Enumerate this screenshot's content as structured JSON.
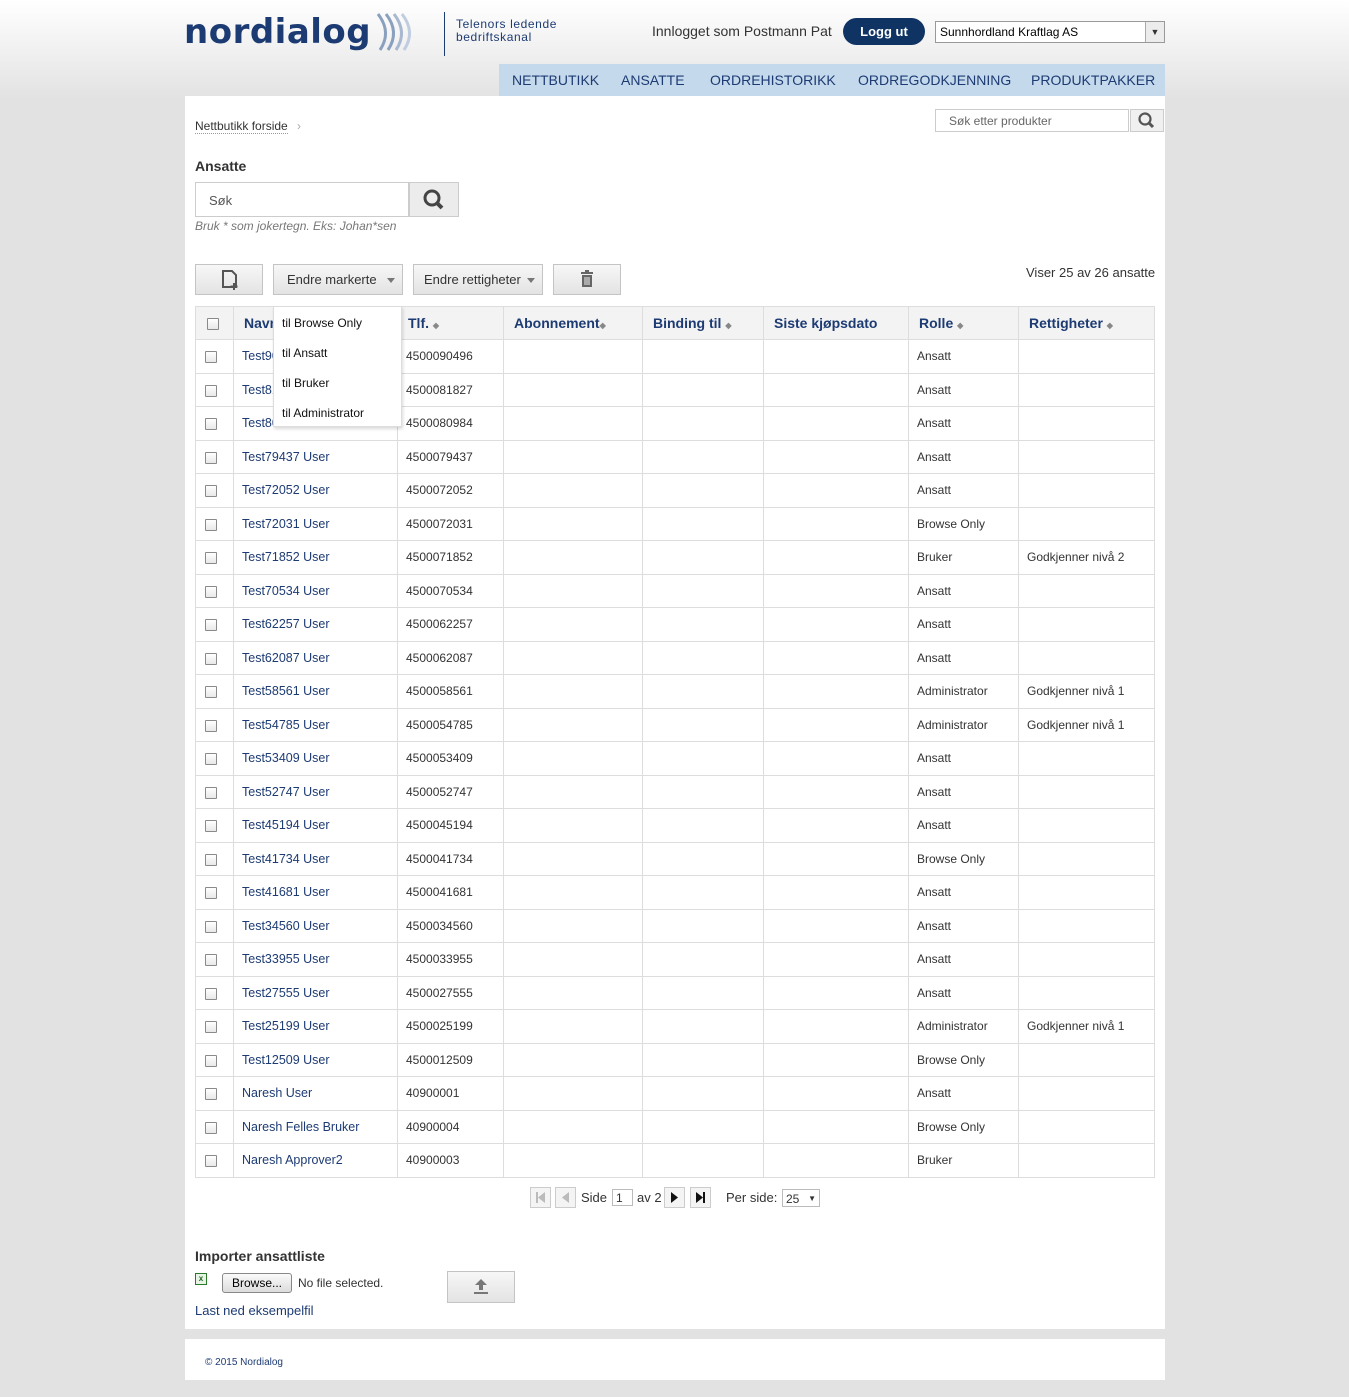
{
  "header": {
    "logo_text": "nordialog",
    "tagline_line1": "Telenors ledende",
    "tagline_line2": "bedriftskanal",
    "logged_in_text": "Innlogget som Postmann Pat",
    "logout_label": "Logg ut",
    "company_selected": "Sunnhordland Kraftlag AS"
  },
  "nav": {
    "items": [
      "NETTBUTIKK",
      "ANSATTE",
      "ORDREHISTORIKK",
      "ORDREGODKJENNING",
      "PRODUKTPAKKER"
    ]
  },
  "breadcrumb": {
    "home": "Nettbutikk forside"
  },
  "product_search": {
    "placeholder": "Søk etter produkter"
  },
  "page": {
    "title": "Ansatte",
    "search_placeholder": "Søk",
    "search_hint": "Bruk * som jokertegn. Eks: Johan*sen",
    "count_text": "Viser 25 av 26 ansatte"
  },
  "toolbar": {
    "change_marked_label": "Endre markerte",
    "change_rights_label": "Endre rettigheter"
  },
  "dropdown": {
    "options": [
      "til Browse Only",
      "til Ansatt",
      "til Bruker",
      "til Administrator"
    ]
  },
  "table": {
    "columns": [
      "Navn",
      "Tlf.",
      "Abonnement",
      "Binding til",
      "Siste kjøpsdato",
      "Rolle",
      "Rettigheter"
    ],
    "rows": [
      {
        "name": "Test90496 User",
        "phone": "4500090496",
        "role": "Ansatt",
        "rights": ""
      },
      {
        "name": "Test81827 User",
        "phone": "4500081827",
        "role": "Ansatt",
        "rights": ""
      },
      {
        "name": "Test80984 User",
        "phone": "4500080984",
        "role": "Ansatt",
        "rights": ""
      },
      {
        "name": "Test79437 User",
        "phone": "4500079437",
        "role": "Ansatt",
        "rights": ""
      },
      {
        "name": "Test72052 User",
        "phone": "4500072052",
        "role": "Ansatt",
        "rights": ""
      },
      {
        "name": "Test72031 User",
        "phone": "4500072031",
        "role": "Browse Only",
        "rights": ""
      },
      {
        "name": "Test71852 User",
        "phone": "4500071852",
        "role": "Bruker",
        "rights": "Godkjenner nivå 2"
      },
      {
        "name": "Test70534 User",
        "phone": "4500070534",
        "role": "Ansatt",
        "rights": ""
      },
      {
        "name": "Test62257 User",
        "phone": "4500062257",
        "role": "Ansatt",
        "rights": ""
      },
      {
        "name": "Test62087 User",
        "phone": "4500062087",
        "role": "Ansatt",
        "rights": ""
      },
      {
        "name": "Test58561 User",
        "phone": "4500058561",
        "role": "Administrator",
        "rights": "Godkjenner nivå 1"
      },
      {
        "name": "Test54785 User",
        "phone": "4500054785",
        "role": "Administrator",
        "rights": "Godkjenner nivå 1"
      },
      {
        "name": "Test53409 User",
        "phone": "4500053409",
        "role": "Ansatt",
        "rights": ""
      },
      {
        "name": "Test52747 User",
        "phone": "4500052747",
        "role": "Ansatt",
        "rights": ""
      },
      {
        "name": "Test45194 User",
        "phone": "4500045194",
        "role": "Ansatt",
        "rights": ""
      },
      {
        "name": "Test41734 User",
        "phone": "4500041734",
        "role": "Browse Only",
        "rights": ""
      },
      {
        "name": "Test41681 User",
        "phone": "4500041681",
        "role": "Ansatt",
        "rights": ""
      },
      {
        "name": "Test34560 User",
        "phone": "4500034560",
        "role": "Ansatt",
        "rights": ""
      },
      {
        "name": "Test33955 User",
        "phone": "4500033955",
        "role": "Ansatt",
        "rights": ""
      },
      {
        "name": "Test27555 User",
        "phone": "4500027555",
        "role": "Ansatt",
        "rights": ""
      },
      {
        "name": "Test25199 User",
        "phone": "4500025199",
        "role": "Administrator",
        "rights": "Godkjenner nivå 1"
      },
      {
        "name": "Test12509 User",
        "phone": "4500012509",
        "role": "Browse Only",
        "rights": ""
      },
      {
        "name": "Naresh User",
        "phone": "40900001",
        "role": "Ansatt",
        "rights": ""
      },
      {
        "name": "Naresh Felles Bruker",
        "phone": "40900004",
        "role": "Browse Only",
        "rights": ""
      },
      {
        "name": "Naresh Approver2",
        "phone": "40900003",
        "role": "Bruker",
        "rights": ""
      }
    ]
  },
  "pager": {
    "page_label": "Side",
    "page_value": "1",
    "of_text": "av 2",
    "per_page_label": "Per side:",
    "per_page_value": "25"
  },
  "import": {
    "title": "Importer ansattliste",
    "browse_label": "Browse...",
    "no_file_text": "No file selected.",
    "sample_link": "Last ned eksempelfil"
  },
  "footer": {
    "copyright": "© 2015 Nordialog"
  },
  "colors": {
    "brand": "#1d3b73",
    "nav_bg": "#c5d9ec",
    "logout_bg": "#0f3464"
  }
}
